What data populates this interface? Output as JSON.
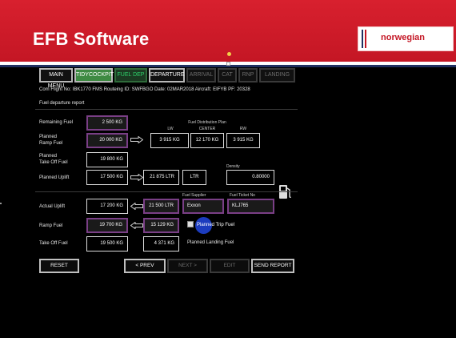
{
  "header": {
    "title": "EFB Software",
    "logo_text": "norwegian",
    "brand_red": "#c41624",
    "navy": "#1f2f60"
  },
  "tabs": [
    {
      "label": "MAIN MENU",
      "state": "active"
    },
    {
      "label": "TIDYCOCKPIT",
      "state": "green-active"
    },
    {
      "label": "FUEL DEP",
      "state": "green"
    },
    {
      "label": "DEPARTURE",
      "state": "active"
    },
    {
      "label": "ARRIVAL",
      "state": "disabled"
    },
    {
      "label": "CAT",
      "state": "disabled"
    },
    {
      "label": "RNP",
      "state": "disabled"
    },
    {
      "label": "LANDING",
      "state": "disabled"
    }
  ],
  "flight_info": "Com Flight No: IBK1770   FMS Routeing ID: SWFBGO   Date: 02MAR2018   Aircraft: EIFYB   PF: 20328",
  "section_title": "Fuel departure report",
  "fields": {
    "remaining_fuel": {
      "label": "Remaining Fuel",
      "value": "2 500 KG"
    },
    "planned_ramp_fuel": {
      "label1": "Planned",
      "label2": "Ramp Fuel",
      "value": "20 000 KG"
    },
    "planned_takeoff_fuel": {
      "label1": "Planned",
      "label2": "Take Off Fuel",
      "value": "19 800 KG"
    },
    "planned_uplift": {
      "label": "Planned Uplift",
      "value": "17 500 KG",
      "ltr_value": "21 875 LTR",
      "unit": "LTR"
    },
    "density": {
      "label": "Density",
      "value": "0.80000"
    },
    "actual_uplift": {
      "label": "Actual Uplift",
      "value": "17 200 KG",
      "ltr_value": "21 500 LTR"
    },
    "ramp_fuel": {
      "label": "Ramp Fuel",
      "value": "19 700 KG",
      "trip_value": "15 129 KG"
    },
    "takeoff_fuel": {
      "label": "Take Off Fuel",
      "value": "19 500 KG",
      "landing_value": "4 371 KG"
    }
  },
  "distribution": {
    "title": "Fuel Distribution Plan",
    "columns": [
      "LW",
      "CENTER",
      "RW"
    ],
    "values": [
      "3 915 KG",
      "12 170 KG",
      "3 915 KG"
    ]
  },
  "supplier": {
    "label": "Fuel Supplier",
    "value": "Exxon"
  },
  "ticket": {
    "label": "Fuel Ticket No",
    "value": "KLJ765"
  },
  "planned_trip_fuel": "Planned Trip Fuel",
  "planned_landing_fuel": "Planned Landing Fuel",
  "buttons": {
    "reset": "RESET",
    "prev": "< PREV",
    "next": "NEXT >",
    "edit": "EDIT",
    "send": "SEND REPORT"
  },
  "icons": {
    "fuel_pump": "fuel-pump-icon",
    "checkbox": "checkbox-icon",
    "arrow": "arrow-right-icon"
  }
}
